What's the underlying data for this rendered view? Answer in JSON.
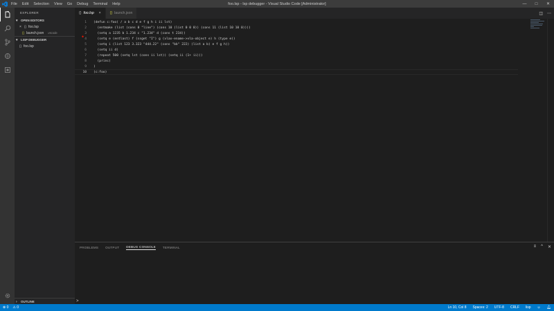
{
  "window": {
    "title": "foo.lsp - lsp debugger - Visual Studio Code [Administrator]",
    "menu": [
      "File",
      "Edit",
      "Selection",
      "View",
      "Go",
      "Debug",
      "Terminal",
      "Help"
    ]
  },
  "sidebar": {
    "header": "EXPLORER",
    "open_editors": {
      "title": "OPEN EDITORS",
      "items": [
        {
          "close": "×",
          "icon": "{}",
          "name": "foo.lsp",
          "path": ""
        },
        {
          "close": "",
          "icon": "{}",
          "name": "launch.json",
          "path": ".vscode"
        }
      ]
    },
    "folder": {
      "title": "LISP DEBUGGER",
      "items": [
        {
          "icon": "{}",
          "name": "foo.lsp"
        }
      ]
    },
    "outline": "OUTLINE"
  },
  "tabs": [
    {
      "icon": "{}",
      "label": "foo.lsp",
      "close": "×",
      "active": true
    },
    {
      "icon": "{}",
      "label": "launch.json",
      "close": "",
      "active": false
    }
  ],
  "editor": {
    "line_numbers": [
      "1",
      "2",
      "3",
      "4",
      "5",
      "6",
      "7",
      "8",
      "9",
      "10"
    ],
    "lines": [
      "(defun c:foo( / a b c d e f g h i ii lst)",
      "  (entmake (list (cons 0 \"line\") (cons 10 (list 0 0 0)) (cons 11 (list 10 10 0))))",
      "  (setq a 1235 b 1.234 c \"1.234\" d (cons t 234))",
      "  (setq e (entlast) f (ssget \"I\") g (vlax-ename->vla-object e) h (type e))",
      "  (setq i (list 123 3.323 \"444.22\" (cons \"bb\" 222) (list a b) e f g h))",
      "  (setq ii d)",
      "  (repeat 500 (setq lst (cons ii lst)) (setq ii (1+ ii)))",
      "  (princ)",
      ")",
      "(c:foo)"
    ]
  },
  "panel": {
    "tabs": [
      "PROBLEMS",
      "OUTPUT",
      "DEBUG CONSOLE",
      "TERMINAL"
    ],
    "active": "DEBUG CONSOLE",
    "prompt": ">"
  },
  "statusbar": {
    "errors": "⊗ 0",
    "warnings": "⚠ 0",
    "position": "Ln 10, Col 8",
    "spaces": "Spaces: 2",
    "encoding": "UTF-8",
    "eol": "CRLF",
    "language": "lisp"
  },
  "colors": {
    "statusbar": "#007acc",
    "activitybar": "#333333",
    "sidebar": "#252526",
    "editor": "#1e1e1e",
    "breakpoint": "#e51400"
  }
}
